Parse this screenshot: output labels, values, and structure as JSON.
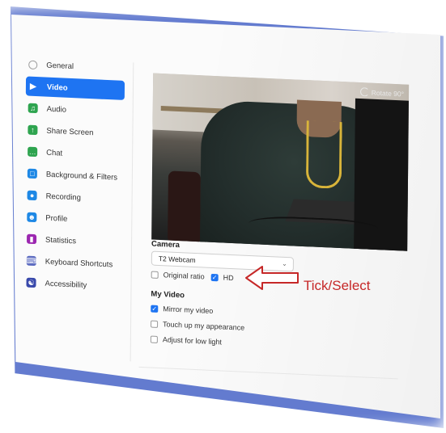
{
  "sidebar": {
    "items": [
      {
        "label": "General",
        "icon": "gear-icon",
        "color": "#9e9e9e",
        "active": false
      },
      {
        "label": "Video",
        "icon": "video-icon",
        "color": "#ffffff",
        "active": true
      },
      {
        "label": "Audio",
        "icon": "headphones-icon",
        "color": "#2ea44f",
        "active": false
      },
      {
        "label": "Share Screen",
        "icon": "share-screen-icon",
        "color": "#2ea44f",
        "active": false
      },
      {
        "label": "Chat",
        "icon": "chat-icon",
        "color": "#2ea44f",
        "active": false
      },
      {
        "label": "Background & Filters",
        "icon": "background-icon",
        "color": "#1e88e5",
        "active": false
      },
      {
        "label": "Recording",
        "icon": "recording-icon",
        "color": "#1e88e5",
        "active": false
      },
      {
        "label": "Profile",
        "icon": "profile-icon",
        "color": "#1e88e5",
        "active": false
      },
      {
        "label": "Statistics",
        "icon": "statistics-icon",
        "color": "#9c27b0",
        "active": false
      },
      {
        "label": "Keyboard Shortcuts",
        "icon": "keyboard-icon",
        "color": "#5c6bc0",
        "active": false
      },
      {
        "label": "Accessibility",
        "icon": "accessibility-icon",
        "color": "#3949ab",
        "active": false
      }
    ]
  },
  "preview": {
    "rotate_label": "Rotate 90°"
  },
  "camera": {
    "heading": "Camera",
    "selected": "T2 Webcam",
    "original_ratio_label": "Original ratio",
    "original_ratio_checked": false,
    "hd_label": "HD",
    "hd_checked": true
  },
  "my_video": {
    "heading": "My Video",
    "options": [
      {
        "label": "Mirror my video",
        "checked": true
      },
      {
        "label": "Touch up my appearance",
        "checked": false
      },
      {
        "label": "Adjust for low light",
        "checked": false
      }
    ]
  },
  "annotation": {
    "text": "Tick/Select",
    "color": "#c62828"
  },
  "colors": {
    "accent": "#1e74f2",
    "frame_glow": "#2f4fbf"
  }
}
